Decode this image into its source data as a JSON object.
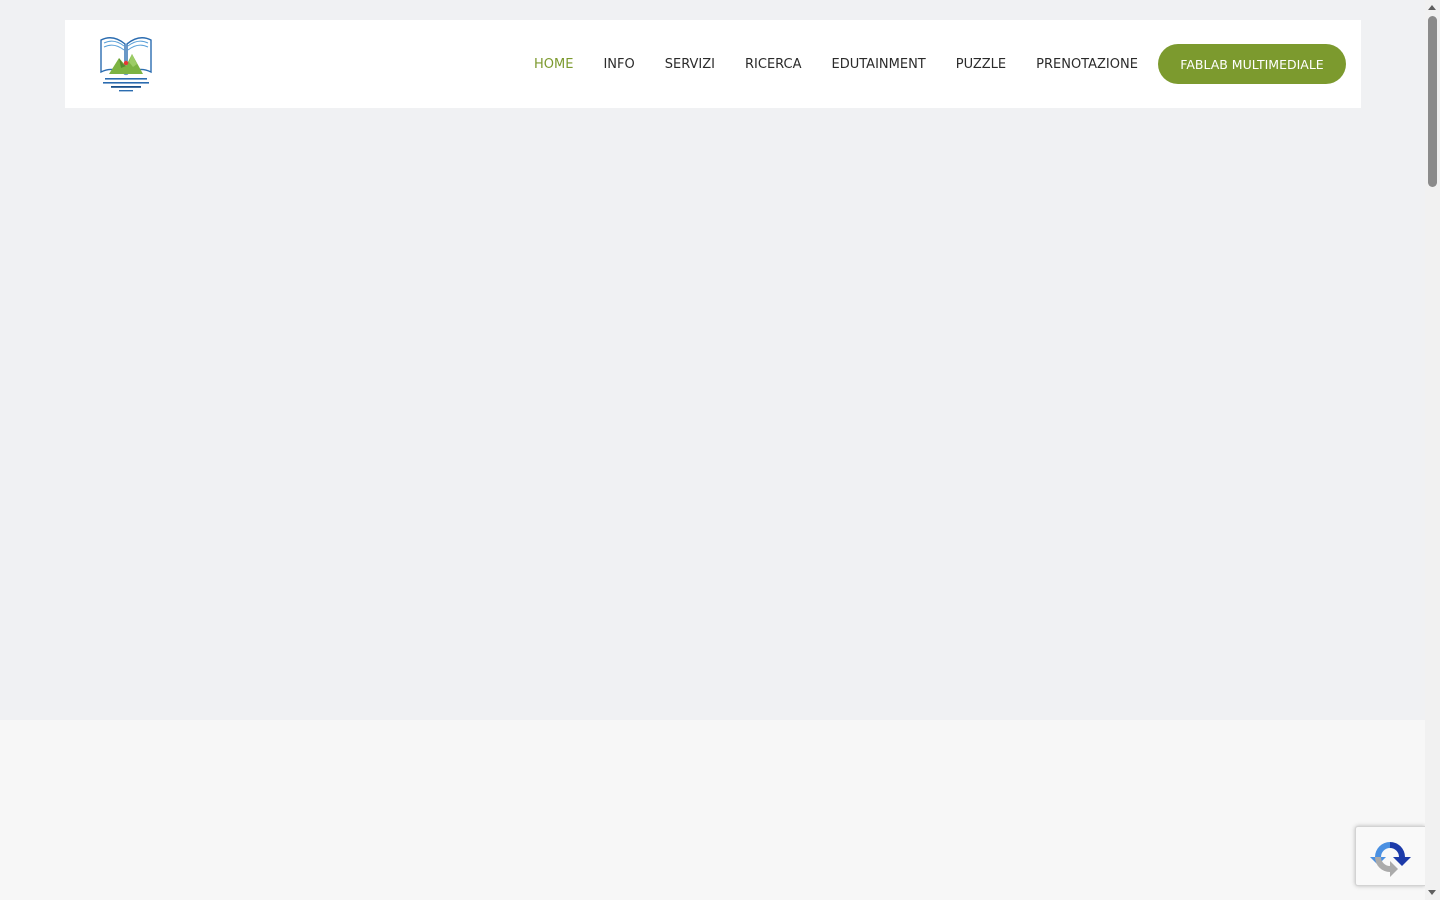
{
  "header": {
    "logo_alt": "Biblioteca logo",
    "nav": [
      {
        "label": "HOME",
        "active": true
      },
      {
        "label": "INFO",
        "active": false
      },
      {
        "label": "SERVIZI",
        "active": false
      },
      {
        "label": "RICERCA",
        "active": false
      },
      {
        "label": "EDUTAINMENT",
        "active": false
      },
      {
        "label": "PUZZLE",
        "active": false
      },
      {
        "label": "PRENOTAZIONE",
        "active": false
      }
    ],
    "cta_label": "FABLAB MULTIMEDIALE"
  },
  "widgets": {
    "recaptcha_icon": "recaptcha-icon"
  },
  "colors": {
    "accent": "#7c9a2e",
    "page_bg": "#f0f1f3",
    "lower_bg": "#f7f7f7",
    "header_bg": "#ffffff",
    "nav_text": "#2b2b2b"
  }
}
